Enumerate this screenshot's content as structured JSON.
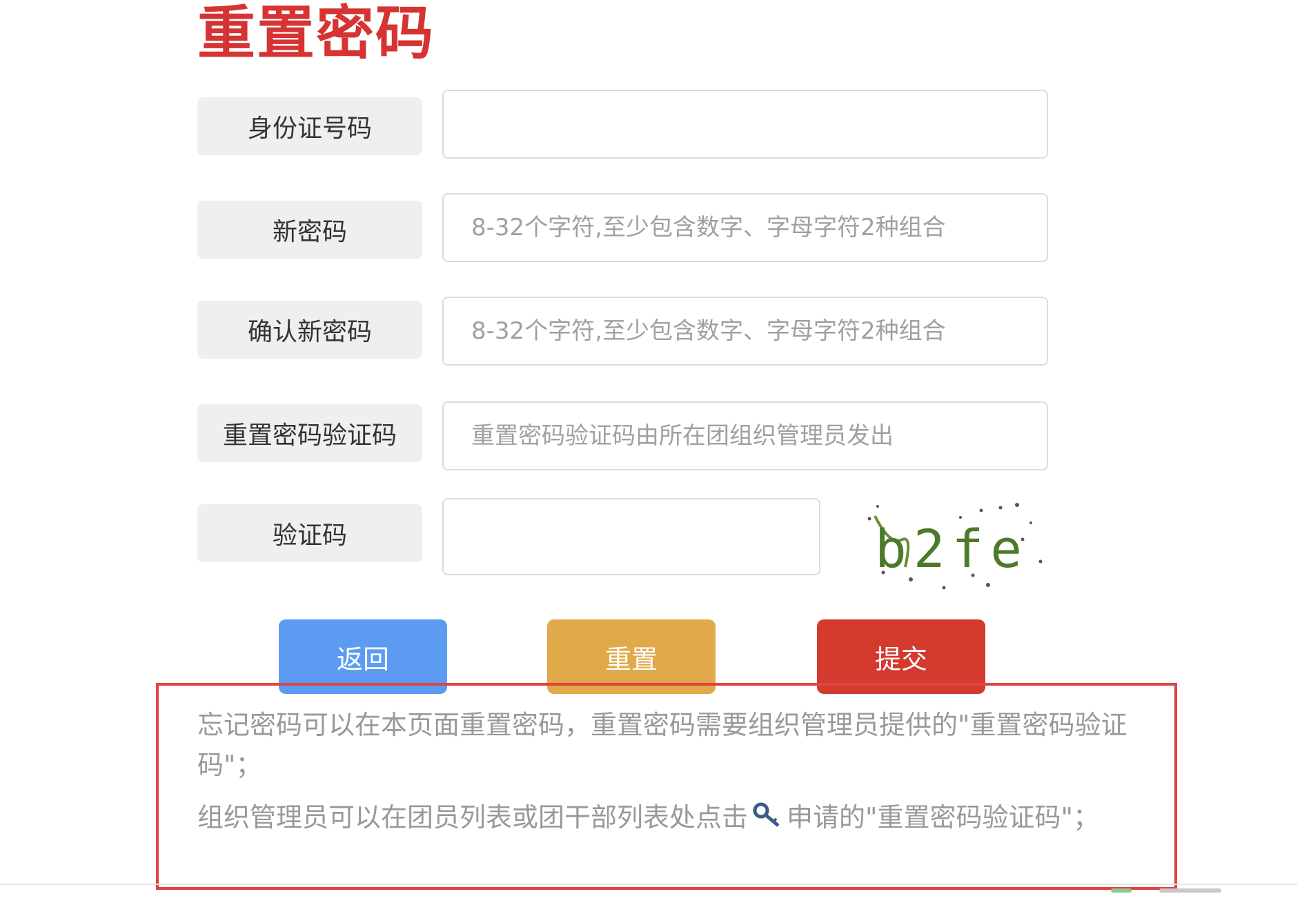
{
  "page": {
    "title": "重置密码"
  },
  "form": {
    "id_number": {
      "label": "身份证号码",
      "placeholder": ""
    },
    "new_password": {
      "label": "新密码",
      "placeholder": "8-32个字符,至少包含数字、字母字符2种组合"
    },
    "confirm_password": {
      "label": "确认新密码",
      "placeholder": "8-32个字符,至少包含数字、字母字符2种组合"
    },
    "reset_code": {
      "label": "重置密码验证码",
      "placeholder": "重置密码验证码由所在团组织管理员发出"
    },
    "captcha": {
      "label": "验证码",
      "placeholder": "",
      "image_text": "b2fe"
    }
  },
  "buttons": {
    "back": "返回",
    "reset": "重置",
    "submit": "提交"
  },
  "notice": {
    "line1": "忘记密码可以在本页面重置密码，重置密码需要组织管理员提供的\"重置密码验证码\"；",
    "line2_before": "组织管理员可以在团员列表或团干部列表处点击",
    "line2_icon": "key-icon",
    "line2_after": "申请的\"重置密码验证码\"；"
  },
  "colors": {
    "title": "#d63333",
    "back_button": "#5b9cf2",
    "reset_button": "#e0a94a",
    "submit_button": "#d43a2e",
    "notice_border": "#e14343"
  }
}
